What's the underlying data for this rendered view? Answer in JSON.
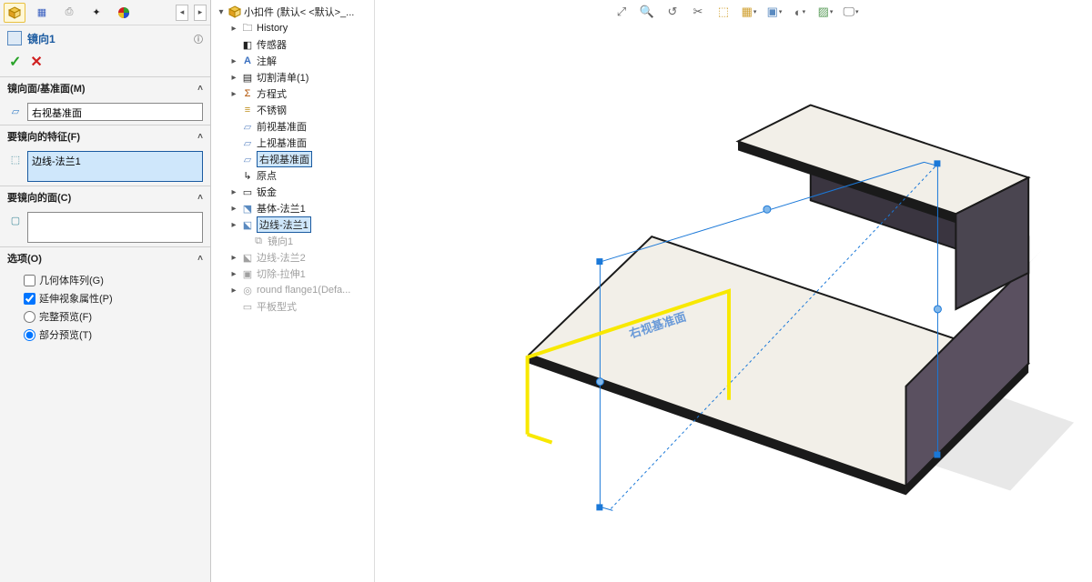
{
  "panel": {
    "title": "镜向1",
    "sections": {
      "mirrorPlane": {
        "title": "镜向面/基准面(M)",
        "value": "右视基准面"
      },
      "featuresToMirror": {
        "title": "要镜向的特征(F)",
        "value": "边线-法兰1"
      },
      "facesToMirror": {
        "title": "要镜向的面(C)",
        "value": ""
      },
      "options": {
        "title": "选项(O)",
        "bodyPattern": "几何体阵列(G)",
        "propagateVisual": "延伸视象属性(P)",
        "fullPreview": "完整预览(F)",
        "partialPreview": "部分预览(T)"
      }
    }
  },
  "tree": {
    "root": "小扣件  (默认< <默认>_...",
    "history": "History",
    "sensors": "传感器",
    "annotations": "注解",
    "cutList": "切割清单(1)",
    "equations": "方程式",
    "material": "不锈钢",
    "frontPlane": "前视基准面",
    "topPlane": "上视基准面",
    "rightPlane": "右视基准面",
    "origin": "原点",
    "sheetMetal": "钣金",
    "baseFlange": "基体-法兰1",
    "edgeFlange1": "边线-法兰1",
    "mirror1": "镜向1",
    "edgeFlange2": "边线-法兰2",
    "cutExtrude": "切除-拉伸1",
    "roundFlange": "round flange1(Defa...",
    "flatPattern": "平板型式"
  },
  "viewport": {
    "planeLabel": "右视基准面"
  }
}
